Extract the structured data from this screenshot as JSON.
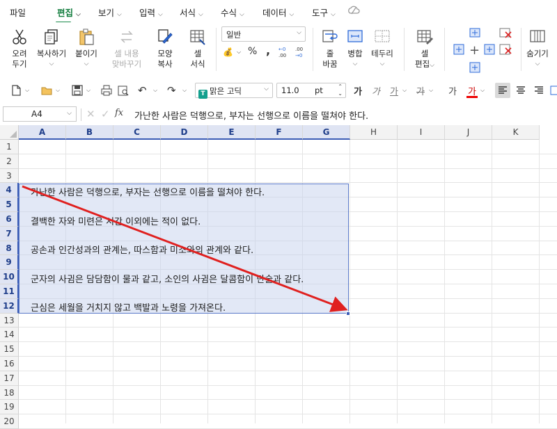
{
  "menu": {
    "tabs": [
      {
        "label": "파일"
      },
      {
        "label": "편집"
      },
      {
        "label": "보기"
      },
      {
        "label": "입력"
      },
      {
        "label": "서식"
      },
      {
        "label": "수식"
      },
      {
        "label": "데이터"
      },
      {
        "label": "도구"
      }
    ],
    "active_tab": "편집"
  },
  "ribbon": {
    "cut": {
      "line1": "오려",
      "line2": "두기"
    },
    "copy": {
      "line1": "복사하기"
    },
    "paste": {
      "line1": "붙이기"
    },
    "paste_content": {
      "line1": "셀 내용",
      "line2": "맞바꾸기"
    },
    "format_copy": {
      "line1": "모양",
      "line2": "복사"
    },
    "cell_format": {
      "line1": "셀",
      "line2": "서식"
    },
    "number_format": "일반",
    "percent": "%",
    "comma": ",",
    "wrap": {
      "line1": "줄",
      "line2": "바꿈"
    },
    "merge": {
      "line1": "병합"
    },
    "border": {
      "line1": "테두리"
    },
    "cell_edit": {
      "line1": "셀",
      "line2": "편집"
    },
    "hide": {
      "line1": "숨기기"
    }
  },
  "toolbar": {
    "font_name": "맑은 고딕",
    "font_size": "11.0",
    "font_unit": "pt",
    "bold_label": "가",
    "italic_label": "가",
    "underline_label": "가",
    "strike_label": "가",
    "super_label": "가",
    "color_label": "가"
  },
  "formula_bar": {
    "cell_ref": "A4",
    "fx": "fx",
    "content": "가난한 사람은 덕행으로, 부자는 선행으로 이름을 떨쳐야 한다."
  },
  "grid": {
    "columns": [
      "A",
      "B",
      "C",
      "D",
      "E",
      "F",
      "G",
      "H",
      "I",
      "J",
      "K"
    ],
    "rows": [
      "1",
      "2",
      "3",
      "4",
      "5",
      "6",
      "7",
      "8",
      "9",
      "10",
      "11",
      "12",
      "13",
      "14",
      "15",
      "16",
      "17",
      "18",
      "19",
      "20"
    ],
    "selected_range": "A4:G12",
    "cells": [
      {
        "ref": "A4",
        "text": "가난한 사람은 덕행으로, 부자는 선행으로 이름을 떨쳐야 한다."
      },
      {
        "ref": "A6",
        "text": "결백한 자와 미련은 시간 이외에는 적이 없다."
      },
      {
        "ref": "A8",
        "text": "공손과 인간성과의 관계는, 따스함과 미소와의 관계와 같다."
      },
      {
        "ref": "A10",
        "text": "군자의 사귐은 담담함이 물과 같고, 소인의 사귐은 달콤함이 단술과 같다."
      },
      {
        "ref": "A12",
        "text": "근심은 세월을 거치지 않고 백발과 노령을 가져온다."
      }
    ]
  },
  "colors": {
    "accent": "#1a8a4a",
    "selection": "#dfe4f3",
    "arrow": "#e0201f"
  }
}
